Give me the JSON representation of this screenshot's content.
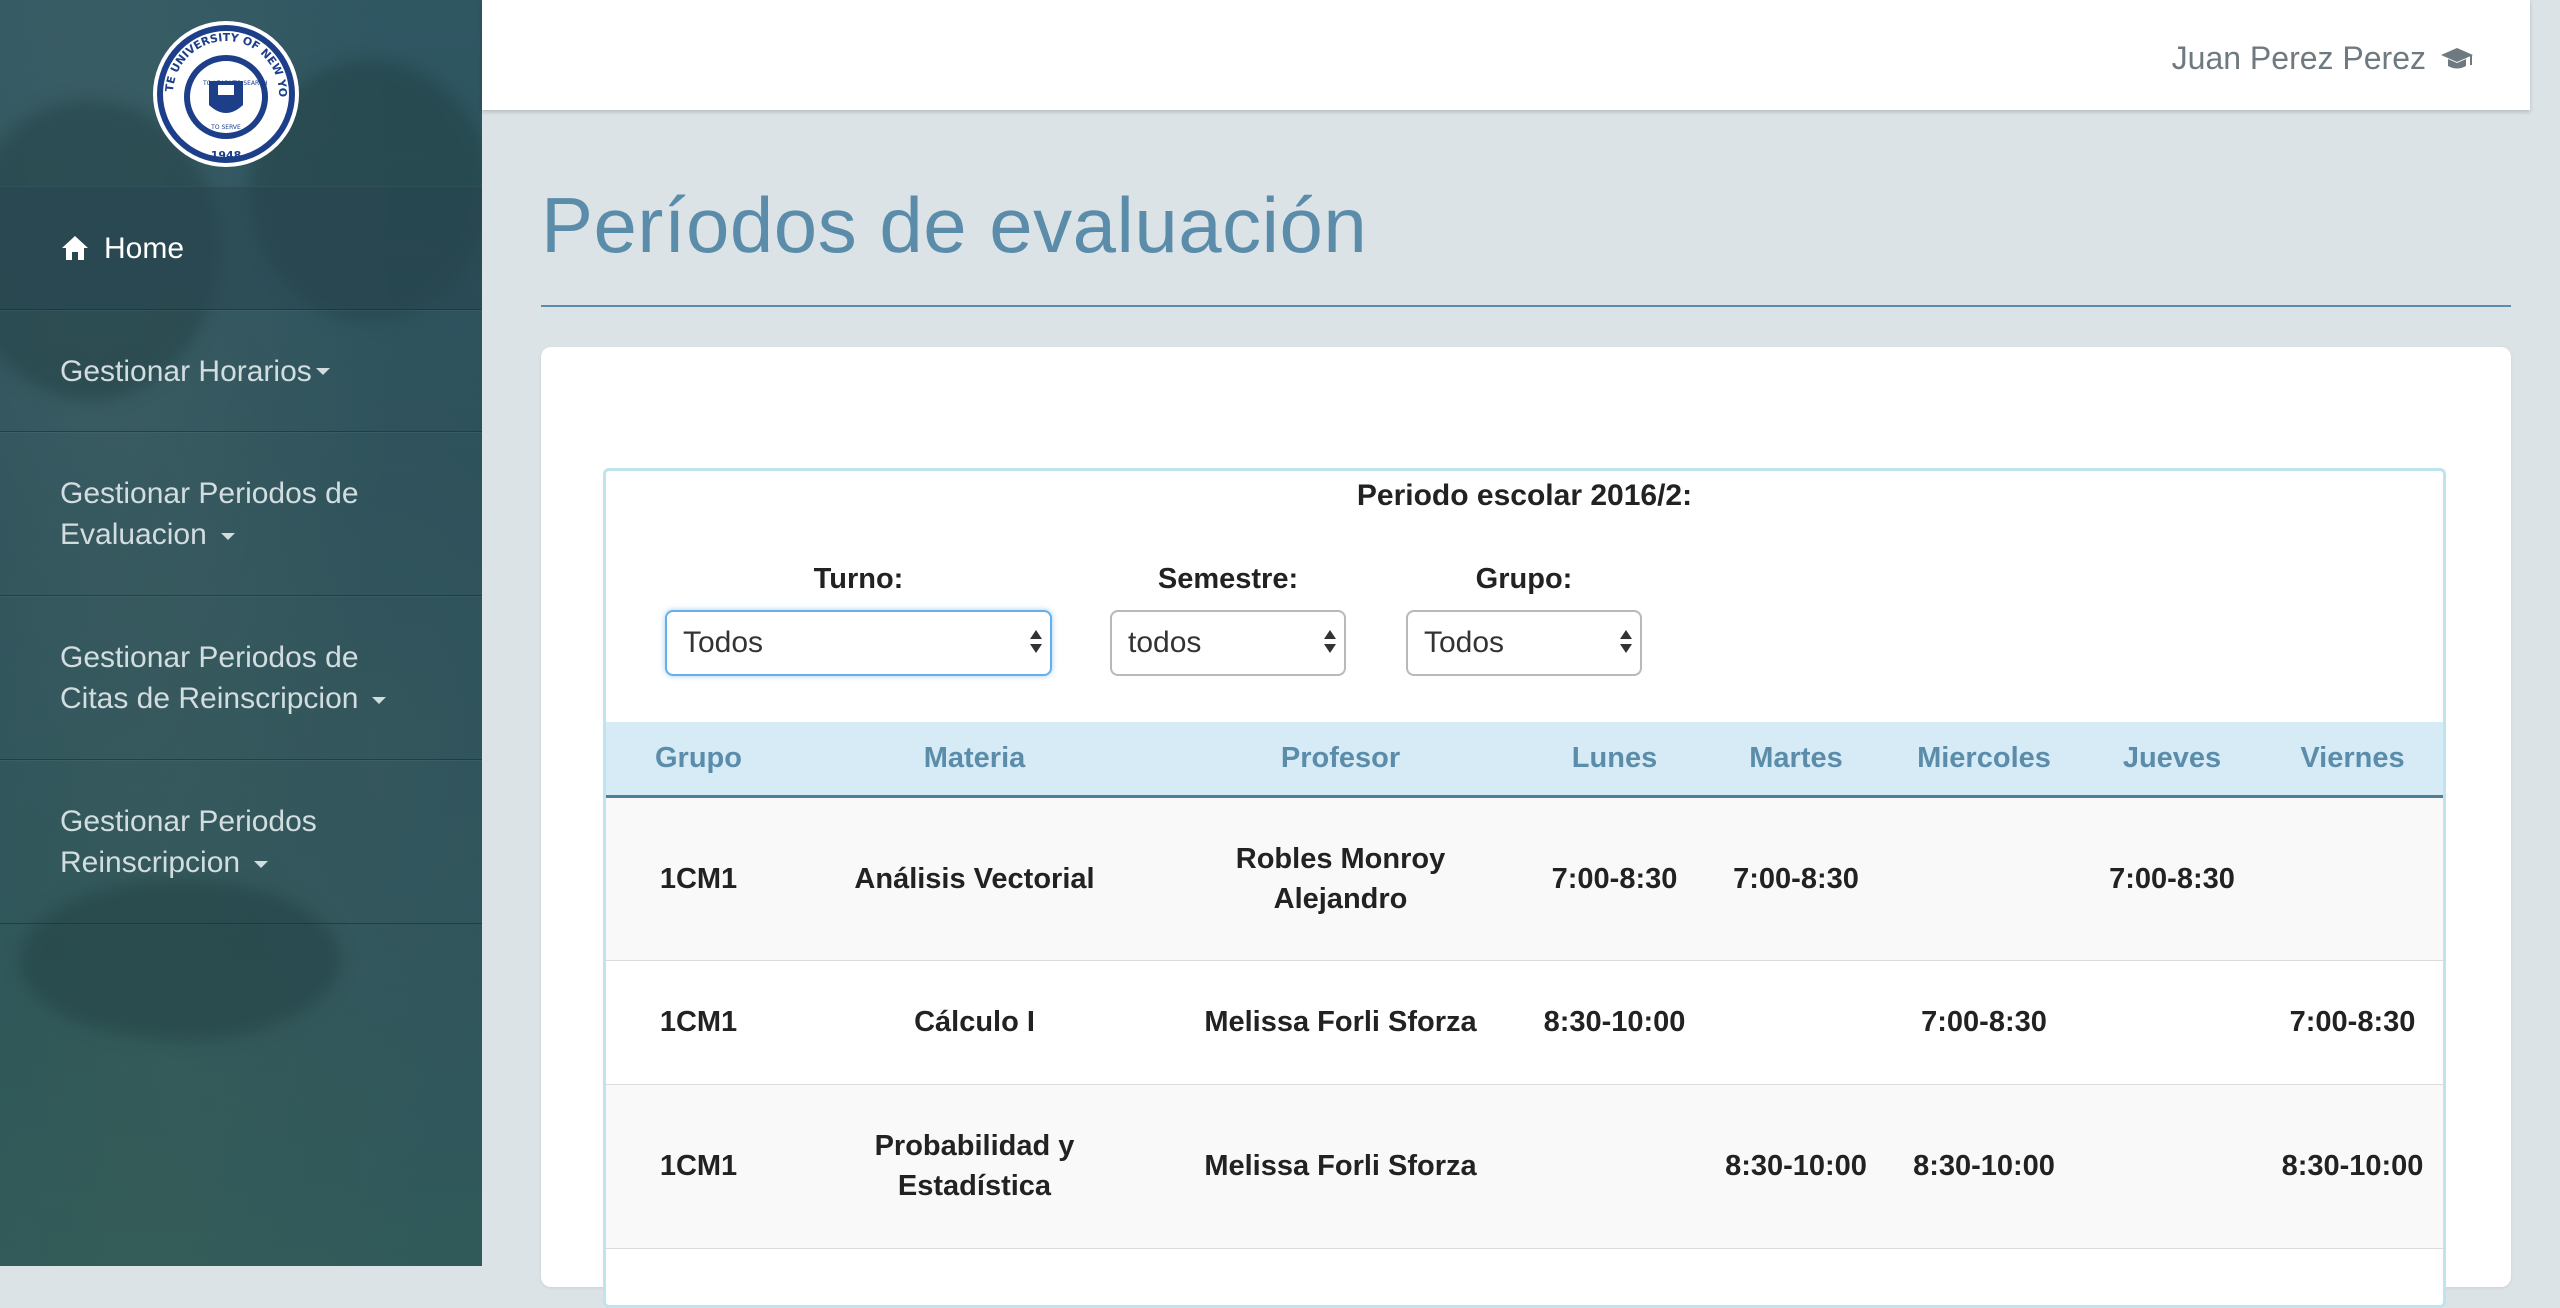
{
  "sidebar": {
    "logo": {
      "top_text": "STATE UNIVERSITY OF NEW YORK",
      "motto_1": "TO LEARN",
      "motto_2": "TO SEARCH",
      "motto_3": "TO SERVE",
      "year": "1948"
    },
    "items": [
      {
        "label": "Home",
        "icon": "home-icon"
      },
      {
        "label": "Gestionar Horarios"
      },
      {
        "label_line1": "Gestionar Periodos de",
        "label_line2": "Evaluacion"
      },
      {
        "label_line1": "Gestionar Periodos de",
        "label_line2": "Citas de Reinscripcion"
      },
      {
        "label_line1": "Gestionar Periodos",
        "label_line2": "Reinscripcion"
      }
    ]
  },
  "header": {
    "user_name": "Juan Perez Perez",
    "user_icon": "graduation-cap-icon"
  },
  "main": {
    "title": "Períodos de evaluación",
    "period_label": "Periodo escolar 2016/2:",
    "filters": {
      "turno": {
        "label": "Turno:",
        "value": "Todos"
      },
      "semestre": {
        "label": "Semestre:",
        "value": "todos"
      },
      "grupo": {
        "label": "Grupo:",
        "value": "Todos"
      }
    },
    "table": {
      "headers": [
        "Grupo",
        "Materia",
        "Profesor",
        "Lunes",
        "Martes",
        "Miercoles",
        "Jueves",
        "Viernes"
      ],
      "rows": [
        {
          "grupo": "1CM1",
          "materia": "Análisis Vectorial",
          "profesor_1": "Robles Monroy",
          "profesor_2": "Alejandro",
          "lunes": "7:00-8:30",
          "martes": "7:00-8:30",
          "miercoles": "",
          "jueves": "7:00-8:30",
          "viernes": ""
        },
        {
          "grupo": "1CM1",
          "materia": "Cálculo I",
          "profesor": "Melissa Forli Sforza",
          "lunes": "8:30-10:00",
          "martes": "",
          "miercoles": "7:00-8:30",
          "jueves": "",
          "viernes": "7:00-8:30"
        },
        {
          "grupo": "1CM1",
          "materia_1": "Probabilidad y",
          "materia_2": "Estadística",
          "profesor": "Melissa Forli Sforza",
          "lunes": "",
          "martes": "8:30-10:00",
          "miercoles": "8:30-10:00",
          "jueves": "",
          "viernes": "8:30-10:00"
        }
      ]
    }
  },
  "colors": {
    "accent": "#5b8dab",
    "table_header_bg": "#d6ebf5",
    "sidebar_bg": "#2b535b"
  }
}
